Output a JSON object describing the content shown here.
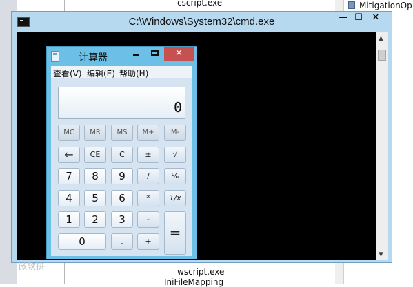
{
  "background": {
    "tree_items": [
      "cscript.exe",
      "wscript.exe",
      "IniFileMapping"
    ],
    "right_pane_item": "MitigationOp"
  },
  "cmd": {
    "title": "C:\\Windows\\System32\\cmd.exe",
    "minimize_label": "—",
    "maximize_label": "☐",
    "close_label": "✕",
    "console_text": "微软拼"
  },
  "calculator": {
    "title": "计算器",
    "close_label": "✕",
    "menu": [
      "查看(V)",
      "编辑(E)",
      "帮助(H)"
    ],
    "display": "0",
    "memory_keys": [
      "MC",
      "MR",
      "MS",
      "M+",
      "M-"
    ],
    "row2": [
      "←",
      "CE",
      "C",
      "±",
      "√"
    ],
    "row3": [
      "7",
      "8",
      "9",
      "/",
      "%"
    ],
    "row4": [
      "4",
      "5",
      "6",
      "*",
      "1/x"
    ],
    "row5": [
      "1",
      "2",
      "3",
      "-"
    ],
    "row6": [
      "0",
      ".",
      "+"
    ],
    "equals": "="
  }
}
